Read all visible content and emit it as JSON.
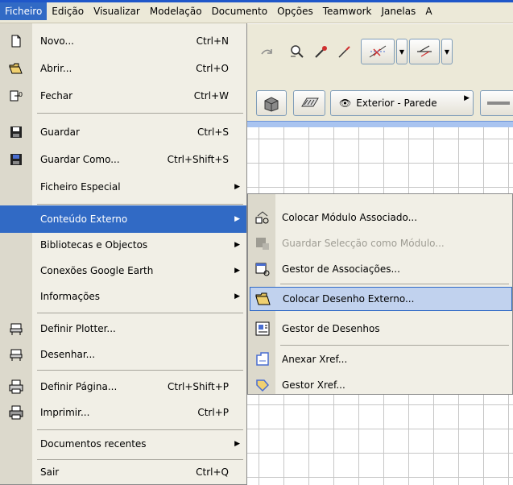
{
  "menubar": {
    "items": [
      "Ficheiro",
      "Edição",
      "Visualizar",
      "Modelação",
      "Documento",
      "Opções",
      "Teamwork",
      "Janelas",
      "A"
    ]
  },
  "toolbar": {
    "wall_label": "Exterior - Parede"
  },
  "file_menu": {
    "items": [
      {
        "label": "Novo...",
        "shortcut": "Ctrl+N",
        "icon": "new-document-icon"
      },
      {
        "label": "Abrir...",
        "shortcut": "Ctrl+O",
        "icon": "open-folder-icon"
      },
      {
        "label": "Fechar",
        "shortcut": "Ctrl+W",
        "icon": "close-document-icon"
      },
      {
        "label": "Guardar",
        "shortcut": "Ctrl+S",
        "icon": "floppy-disk-icon"
      },
      {
        "label": "Guardar Como...",
        "shortcut": "Ctrl+Shift+S",
        "icon": "save-as-icon"
      },
      {
        "label": "Ficheiro Especial",
        "shortcut": "",
        "icon": ""
      },
      {
        "label": "Conteúdo Externo",
        "shortcut": "",
        "icon": ""
      },
      {
        "label": "Bibliotecas e Objectos",
        "shortcut": "",
        "icon": ""
      },
      {
        "label": "Conexões Google Earth",
        "shortcut": "",
        "icon": ""
      },
      {
        "label": "Informações",
        "shortcut": "",
        "icon": ""
      },
      {
        "label": "Definir Plotter...",
        "shortcut": "",
        "icon": "plotter-setup-icon"
      },
      {
        "label": "Desenhar...",
        "shortcut": "",
        "icon": "plotter-icon"
      },
      {
        "label": "Definir Página...",
        "shortcut": "Ctrl+Shift+P",
        "icon": "page-setup-icon"
      },
      {
        "label": "Imprimir...",
        "shortcut": "Ctrl+P",
        "icon": "printer-icon"
      },
      {
        "label": "Documentos recentes",
        "shortcut": "",
        "icon": ""
      },
      {
        "label": "Sair",
        "shortcut": "Ctrl+Q",
        "icon": ""
      }
    ]
  },
  "submenu": {
    "items": [
      {
        "label": "Colocar Módulo Associado...",
        "icon": "place-module-icon",
        "disabled": false
      },
      {
        "label": "Guardar Selecção como Módulo...",
        "icon": "save-module-icon",
        "disabled": true
      },
      {
        "label": "Gestor de Associações...",
        "icon": "hotlink-manager-icon",
        "disabled": false
      },
      {
        "label": "Colocar Desenho Externo...",
        "icon": "place-drawing-icon",
        "disabled": false
      },
      {
        "label": "Gestor de Desenhos",
        "icon": "drawing-manager-icon",
        "disabled": false
      },
      {
        "label": "Anexar Xref...",
        "icon": "attach-xref-icon",
        "disabled": false
      },
      {
        "label": "Gestor Xref...",
        "icon": "xref-manager-icon",
        "disabled": false
      }
    ]
  },
  "colors": {
    "selection": "#316ac5",
    "hover_highlight": "#c1d2ee",
    "menu_bg": "#f1efe6",
    "menubar_bg": "#ece9d8"
  }
}
